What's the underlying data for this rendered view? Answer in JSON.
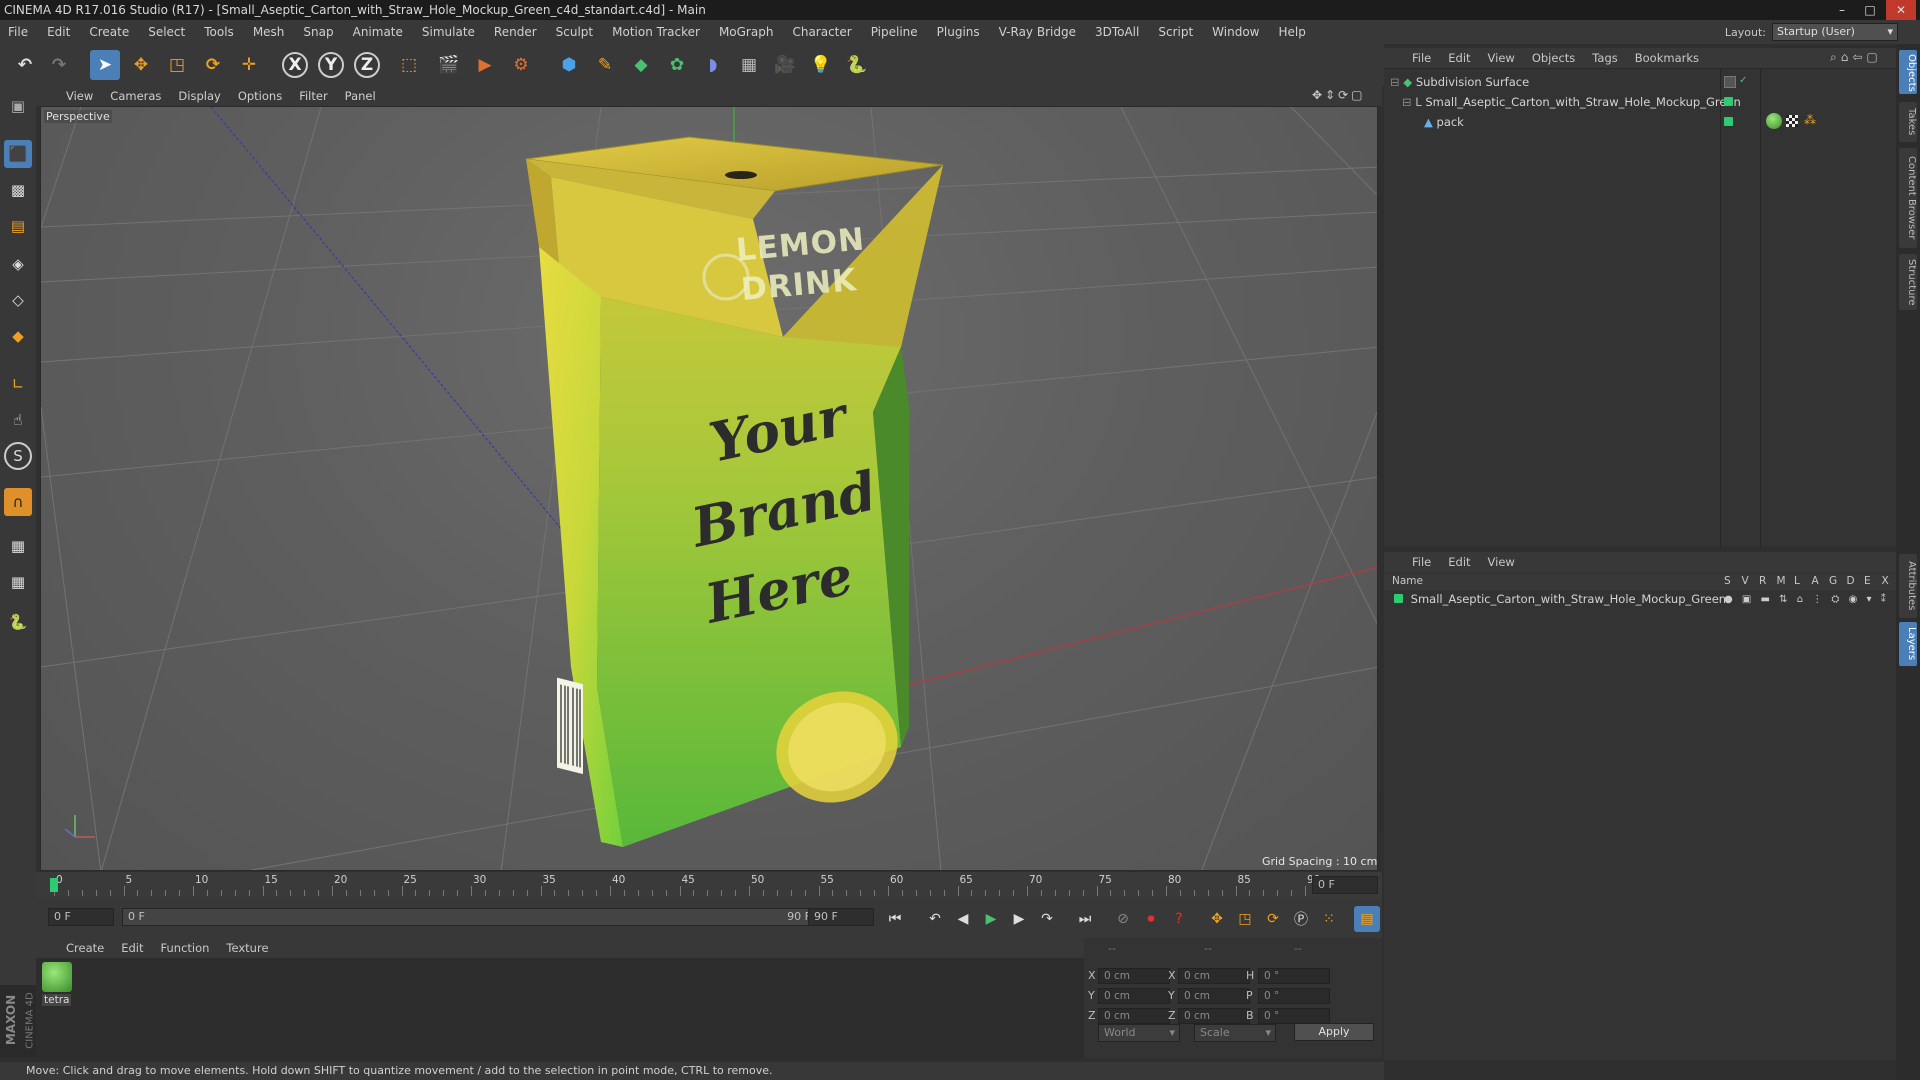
{
  "window": {
    "title": "CINEMA 4D R17.016 Studio (R17) - [Small_Aseptic_Carton_with_Straw_Hole_Mockup_Green_c4d_standart.c4d] - Main",
    "controls": [
      "–",
      "□",
      "✕"
    ]
  },
  "menubar": {
    "items": [
      "File",
      "Edit",
      "Create",
      "Select",
      "Tools",
      "Mesh",
      "Snap",
      "Animate",
      "Simulate",
      "Render",
      "Sculpt",
      "Motion Tracker",
      "MoGraph",
      "Character",
      "Pipeline",
      "Plugins",
      "V-Ray Bridge",
      "3DToAll",
      "Script",
      "Window",
      "Help"
    ],
    "layout_label": "Layout:",
    "layout_value": "Startup (User)"
  },
  "toolbar": {
    "icons": [
      "undo-icon",
      "redo-icon",
      "select-arrow-icon",
      "move-icon",
      "scale-icon",
      "rotate-icon",
      "live-select-icon",
      "x-axis-icon",
      "y-axis-icon",
      "z-axis-icon",
      "coordinate-system-icon",
      "render-view-icon",
      "render-picture-viewer-icon",
      "render-settings-icon",
      "cube-icon",
      "pen-spline-icon",
      "subdivision-icon",
      "array-icon",
      "deformer-icon",
      "floor-icon",
      "camera-icon",
      "light-icon",
      "python-icon"
    ],
    "axis_labels": [
      "X",
      "Y",
      "Z"
    ]
  },
  "viewport": {
    "menu": [
      "View",
      "Cameras",
      "Display",
      "Options",
      "Filter",
      "Panel"
    ],
    "label": "Perspective",
    "grid_spacing": "Grid Spacing : 10 cm",
    "product": {
      "brand_top": "LEMON",
      "brand_bottom": "DRINK",
      "slogan_1": "Your",
      "slogan_2": "Brand",
      "slogan_3": "Here"
    }
  },
  "timeline": {
    "ticks": [
      "0",
      "5",
      "10",
      "15",
      "20",
      "25",
      "30",
      "35",
      "40",
      "45",
      "50",
      "55",
      "60",
      "65",
      "70",
      "75",
      "80",
      "85",
      "90"
    ],
    "current_frame": "0 F",
    "start_field": "0 F",
    "range_start": "0 F",
    "range_end": "90 F",
    "end_field": "90 F"
  },
  "materials": {
    "menu": [
      "Create",
      "Edit",
      "Function",
      "Texture"
    ],
    "items": [
      {
        "name": "tetra"
      }
    ],
    "maxon_logo": "MAXON",
    "c4d_logo": "CINEMA 4D"
  },
  "coordinates": {
    "headers": [
      "--",
      "--",
      "--"
    ],
    "rows": [
      {
        "a": "X",
        "av": "0 cm",
        "b": "X",
        "bv": "0 cm",
        "c": "H",
        "cv": "0 °"
      },
      {
        "a": "Y",
        "av": "0 cm",
        "b": "Y",
        "bv": "0 cm",
        "c": "P",
        "cv": "0 °"
      },
      {
        "a": "Z",
        "av": "0 cm",
        "b": "Z",
        "bv": "0 cm",
        "c": "B",
        "cv": "0 °"
      }
    ],
    "mode_1": "World",
    "mode_2": "Scale",
    "apply": "Apply"
  },
  "status": "Move: Click and drag to move elements. Hold down SHIFT to quantize movement / add to the selection in point mode, CTRL to remove.",
  "objects": {
    "menu": [
      "File",
      "Edit",
      "View",
      "Objects",
      "Tags",
      "Bookmarks"
    ],
    "items": [
      {
        "name": "Subdivision Surface",
        "color": "#7ec86a"
      },
      {
        "name": "Small_Aseptic_Carton_with_Straw_Hole_Mockup_Green",
        "color": "#cfd8e0"
      },
      {
        "name": "pack",
        "color": "#cfd8e0"
      }
    ]
  },
  "layers": {
    "menu": [
      "File",
      "Edit",
      "View"
    ],
    "columns": [
      "Name",
      "S",
      "V",
      "R",
      "M",
      "L",
      "A",
      "G",
      "D",
      "E",
      "X"
    ],
    "rows": [
      {
        "name": "Small_Aseptic_Carton_with_Straw_Hole_Mockup_Green",
        "color": "#2ecc71"
      }
    ]
  },
  "side_tabs": [
    "Objects",
    "Takes",
    "Content Browser",
    "Structure",
    "Attributes",
    "Layers"
  ],
  "colors": {
    "accent_blue": "#4a8fd6",
    "layer_green": "#2ecc71",
    "carton_yellow": "#e6d23a",
    "carton_green": "#64c83c"
  }
}
